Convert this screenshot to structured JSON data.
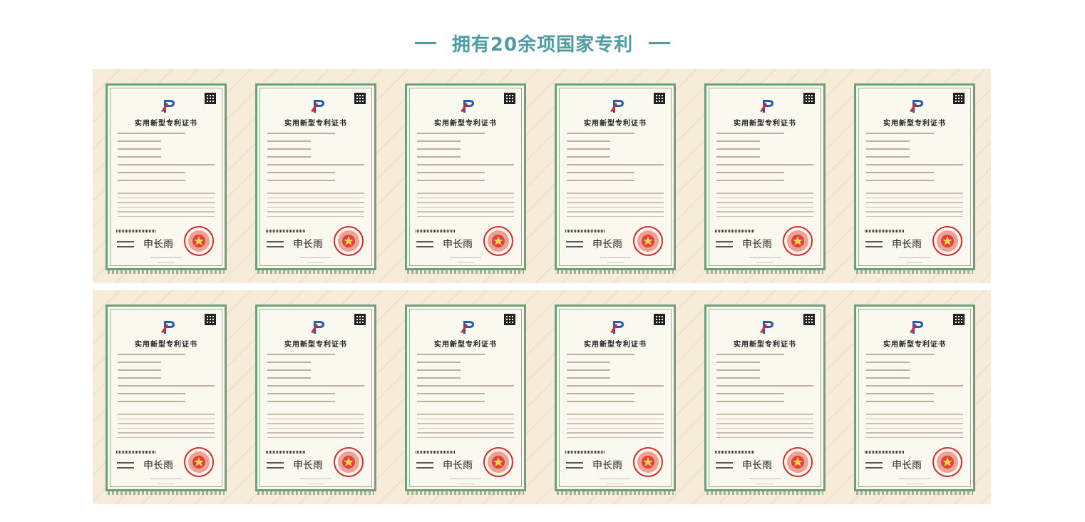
{
  "page": {
    "title": "拥有20余项国家专利"
  },
  "colors": {
    "accent": "#4e9ba2",
    "certificate_border": "#6e9f78",
    "seal_red": "#d92b2b",
    "background_panel": "#f6ecd9"
  },
  "certificates": {
    "title": "实用新型专利证书",
    "signature": "申长雨",
    "row_1_count": 6,
    "row_2_count": 6
  },
  "icons": {
    "logo": "cnipa-logo-icon",
    "seal": "red-seal-icon",
    "qr": "qr-code-icon"
  }
}
